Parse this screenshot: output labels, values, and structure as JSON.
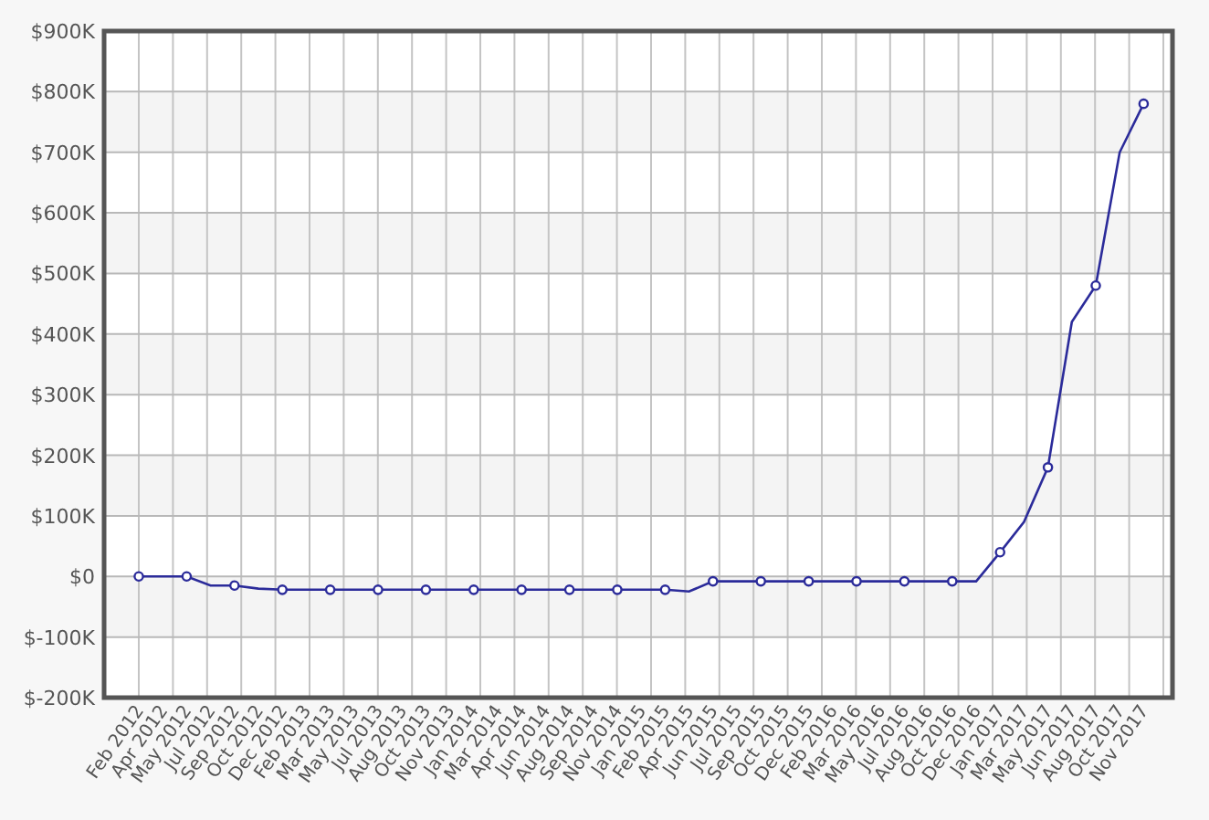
{
  "chart_data": {
    "type": "line",
    "categories": [
      "Feb 2012",
      "Apr 2012",
      "May 2012",
      "Jul 2012",
      "Sep 2012",
      "Oct 2012",
      "Dec 2012",
      "Feb 2013",
      "Mar 2013",
      "May 2013",
      "Jul 2013",
      "Aug 2013",
      "Oct 2013",
      "Nov 2013",
      "Jan 2014",
      "Mar 2014",
      "Apr 2014",
      "Jun 2014",
      "Aug 2014",
      "Sep 2014",
      "Nov 2014",
      "Jan 2015",
      "Feb 2015",
      "Apr 2015",
      "Jun 2015",
      "Jul 2015",
      "Sep 2015",
      "Oct 2015",
      "Dec 2015",
      "Feb 2016",
      "Mar 2016",
      "May 2016",
      "Jul 2016",
      "Aug 2016",
      "Oct 2016",
      "Dec 2016",
      "Jan 2017",
      "Mar 2017",
      "May 2017",
      "Jun 2017",
      "Aug 2017",
      "Oct 2017",
      "Nov 2017"
    ],
    "series": [
      {
        "color": "#2b2b9a",
        "values": [
          0,
          0,
          0,
          -15000,
          -15000,
          -20000,
          -22000,
          -22000,
          -22000,
          -22000,
          -22000,
          -22000,
          -22000,
          -22000,
          -22000,
          -22000,
          -22000,
          -22000,
          -22000,
          -22000,
          -22000,
          -22000,
          -22000,
          -25000,
          -8000,
          -8000,
          -8000,
          -8000,
          -8000,
          -8000,
          -8000,
          -8000,
          -8000,
          -8000,
          -8000,
          -8000,
          40000,
          90000,
          180000,
          420000,
          480000,
          700000,
          780000
        ]
      }
    ],
    "grid": true,
    "ylim": [
      -200000,
      900000
    ],
    "yticks": [
      {
        "value": 900000,
        "label": "$900K"
      },
      {
        "value": 800000,
        "label": "$800K"
      },
      {
        "value": 700000,
        "label": "$700K"
      },
      {
        "value": 600000,
        "label": "$600K"
      },
      {
        "value": 500000,
        "label": "$500K"
      },
      {
        "value": 400000,
        "label": "$400K"
      },
      {
        "value": 300000,
        "label": "$300K"
      },
      {
        "value": 200000,
        "label": "$200K"
      },
      {
        "value": 100000,
        "label": "$100K"
      },
      {
        "value": 0,
        "label": "$0"
      },
      {
        "value": -100000,
        "label": "$-100K"
      },
      {
        "value": -200000,
        "label": "$-200K"
      }
    ]
  }
}
